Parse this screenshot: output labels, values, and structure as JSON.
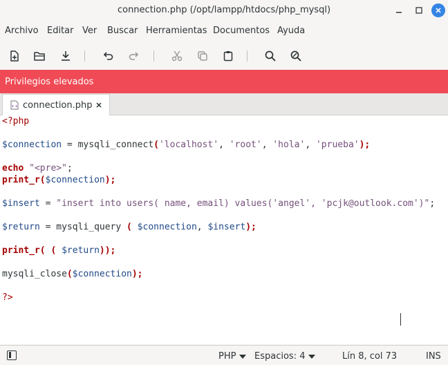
{
  "window": {
    "title": "connection.php (/opt/lampp/htdocs/php_mysql)"
  },
  "menubar": [
    "Archivo",
    "Editar",
    "Ver",
    "Buscar",
    "Herramientas",
    "Documentos",
    "Ayuda"
  ],
  "banner": {
    "text": "Privilegios elevados",
    "color": "#ef4a55"
  },
  "tab": {
    "label": "connection.php"
  },
  "code": [
    [
      {
        "t": "<?php",
        "c": "php-tag"
      }
    ],
    [],
    [
      {
        "t": "$connection",
        "c": "var"
      },
      {
        "t": " = mysqli_connect",
        "c": "plain"
      },
      {
        "t": "(",
        "c": "kw"
      },
      {
        "t": "'localhost'",
        "c": "str"
      },
      {
        "t": ", ",
        "c": "plain"
      },
      {
        "t": "'root'",
        "c": "str"
      },
      {
        "t": ", ",
        "c": "plain"
      },
      {
        "t": "'hola'",
        "c": "str"
      },
      {
        "t": ", ",
        "c": "plain"
      },
      {
        "t": "'prueba'",
        "c": "str"
      },
      {
        "t": ");",
        "c": "kw"
      }
    ],
    [],
    [
      {
        "t": "echo",
        "c": "kw"
      },
      {
        "t": " ",
        "c": "plain"
      },
      {
        "t": "\"<pre>\"",
        "c": "str"
      },
      {
        "t": ";",
        "c": "plain"
      }
    ],
    [
      {
        "t": "print_r(",
        "c": "kw"
      },
      {
        "t": "$connection",
        "c": "var"
      },
      {
        "t": ");",
        "c": "kw"
      }
    ],
    [],
    [
      {
        "t": "$insert",
        "c": "var"
      },
      {
        "t": " = ",
        "c": "plain"
      },
      {
        "t": "\"insert into users( name, email) values('angel', 'pcjk@outlook.com')\"",
        "c": "str"
      },
      {
        "t": ";",
        "c": "plain"
      }
    ],
    [],
    [
      {
        "t": "$return",
        "c": "var"
      },
      {
        "t": " = mysqli_query ",
        "c": "plain"
      },
      {
        "t": "(",
        "c": "kw"
      },
      {
        "t": " ",
        "c": "plain"
      },
      {
        "t": "$connection",
        "c": "var"
      },
      {
        "t": ", ",
        "c": "plain"
      },
      {
        "t": "$insert",
        "c": "var"
      },
      {
        "t": ");",
        "c": "kw"
      }
    ],
    [],
    [
      {
        "t": "print_r(",
        "c": "kw"
      },
      {
        "t": " ( ",
        "c": "kw"
      },
      {
        "t": "$return",
        "c": "var"
      },
      {
        "t": "));",
        "c": "kw"
      }
    ],
    [],
    [
      {
        "t": "mysqli_close",
        "c": "plain"
      },
      {
        "t": "(",
        "c": "kw"
      },
      {
        "t": "$connection",
        "c": "var"
      },
      {
        "t": ");",
        "c": "kw"
      }
    ],
    [],
    [
      {
        "t": "?>",
        "c": "php-tag"
      }
    ]
  ],
  "statusbar": {
    "language": "PHP",
    "indent": "Espacios: 4",
    "position": "Lín 8, col 73",
    "mode": "INS"
  }
}
